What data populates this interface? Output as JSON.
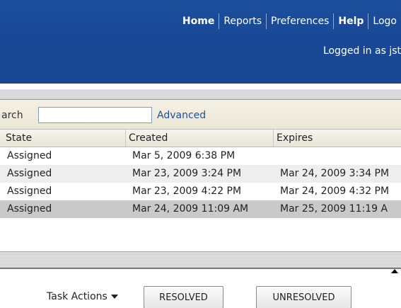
{
  "header": {
    "nav": [
      {
        "label": "Home",
        "bold": true
      },
      {
        "label": "Reports",
        "bold": false
      },
      {
        "label": "Preferences",
        "bold": false
      },
      {
        "label": "Help",
        "bold": true
      },
      {
        "label": "Logo",
        "bold": false
      }
    ],
    "logged_in": "Logged in as jst"
  },
  "toolbar": {
    "search_label": "arch",
    "search_value": "",
    "advanced_label": "Advanced"
  },
  "table": {
    "columns": [
      "State",
      "Created",
      "Expires"
    ],
    "rows": [
      {
        "state": "Assigned",
        "created": "Mar 5, 2009 6:38 PM",
        "expires": ""
      },
      {
        "state": "Assigned",
        "created": "Mar 23, 2009 3:24 PM",
        "expires": "Mar 24, 2009 3:34 PM"
      },
      {
        "state": "Assigned",
        "created": "Mar 23, 2009 4:22 PM",
        "expires": "Mar 24, 2009 4:32 PM"
      },
      {
        "state": "Assigned",
        "created": "Mar 24, 2009 11:09 AM",
        "expires": "Mar 25, 2009 11:19 A"
      }
    ]
  },
  "actions": {
    "task_actions_label": "Task Actions",
    "resolved_label": "RESOLVED",
    "unresolved_label": "UNRESOLVED"
  },
  "colors": {
    "header_blue": "#1a4793",
    "link_blue": "#1f4f99",
    "selected_row": "#c9c9c9"
  }
}
